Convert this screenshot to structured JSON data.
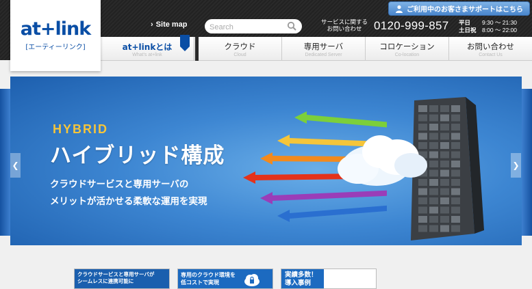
{
  "brand": {
    "logo_main": "at+link",
    "logo_sub": "[エーティーリンク]",
    "accent": "#0a4ea5"
  },
  "header": {
    "sitemap_label": "Site map",
    "search_placeholder": "Search",
    "contact_label_line1": "サービスに関する",
    "contact_label_line2": "お問い合わせ",
    "phone": "0120-999-857",
    "hours": [
      {
        "day": "平日",
        "time": "9:30 ～ 21:30"
      },
      {
        "day": "土日祝",
        "time": "8:00 ～ 22:00"
      }
    ],
    "support_button": "ご利用中のお客さまサポートはこちら"
  },
  "nav": {
    "about": {
      "title": "at+linkとは",
      "sub": "What's at+link"
    },
    "items": [
      {
        "title": "クラウド",
        "sub": "Cloud"
      },
      {
        "title": "専用サーバ",
        "sub": "Dedicated Server"
      },
      {
        "title": "コロケーション",
        "sub": "Co-location"
      },
      {
        "title": "お問い合わせ",
        "sub": "Contact Us"
      }
    ]
  },
  "hero": {
    "kicker": "HYBRID",
    "title": "ハイブリッド構成",
    "sub_line1": "クラウドサービスと専用サーバの",
    "sub_line2": "メリットが活かせる柔軟な運用を実現",
    "arrow_colors": [
      "#7ccf3a",
      "#f5c53a",
      "#f28a1e",
      "#e4321b",
      "#9a3db8",
      "#2a6fd0"
    ]
  },
  "banners": [
    {
      "line1": "クラウドサービスと専用サーバが",
      "line2": "シームレスに連携可能に"
    },
    {
      "line1": "専用のクラウド環境を",
      "line2": "低コストで実現"
    },
    {
      "line1": "実績多数！",
      "line2": "導入事例"
    }
  ]
}
